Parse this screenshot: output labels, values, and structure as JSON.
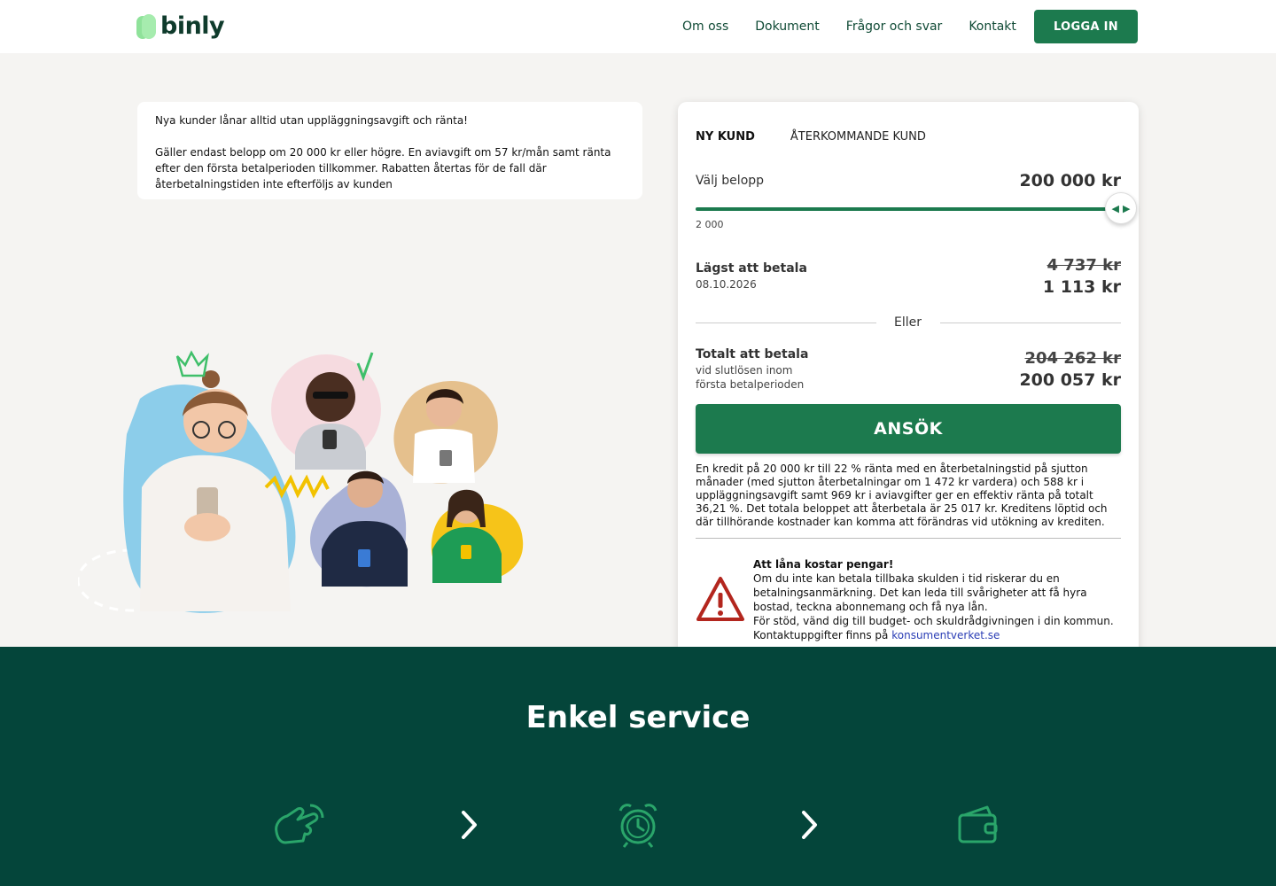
{
  "header": {
    "logo": "binly",
    "nav": [
      "Om oss",
      "Dokument",
      "Frågor och svar",
      "Kontakt"
    ],
    "login": "LOGGA IN"
  },
  "promo": {
    "line1": "Nya kunder lånar alltid utan uppläggningsavgift och ränta!",
    "line2": "Gäller endast belopp om 20 000 kr eller högre. En aviavgift om 57 kr/mån samt ränta efter den första betalperioden tillkommer. Rabatten återtas för de fall där återbetalningstiden inte efterföljs av kunden"
  },
  "calculator": {
    "tabs": [
      "NY KUND",
      "ÅTERKOMMANDE KUND"
    ],
    "active_tab": "NY KUND",
    "choose_label": "Välj belopp",
    "amount": "200 000 kr",
    "slider_min": "2 000",
    "slider_level": 1.0,
    "lowest_label": "Lägst att betala",
    "lowest_date": "08.10.2026",
    "lowest_old": "4 737 kr",
    "lowest_new": "1 113 kr",
    "or": "Eller",
    "total_label": "Totalt att betala",
    "total_sub1": "vid slutlösen inom",
    "total_sub2": "första betalperioden",
    "total_old": "204 262 kr",
    "total_new": "200 057 kr",
    "apply": "ANSÖK",
    "legal": "En kredit på 20 000 kr till 22 % ränta med en återbetalningstid på sjutton månader (med sjutton återbetalningar om 1 472 kr vardera) och 588 kr i uppläggningsavgift samt 969 kr i aviavgifter ger en effektiv ränta på totalt 36,21 %. Det totala beloppet att återbetala är 25 017 kr. Kreditens löptid och där tillhörande kostnader kan komma att förändras vid utökning av krediten.",
    "warning_title": "Att låna kostar pengar!",
    "warning_body": "Om du inte kan betala tillbaka skulden i tid riskerar du en betalningsanmärkning. Det kan leda till svårigheter att få hyra bostad, teckna abonnemang och få nya lån.",
    "warning_support": "För stöd, vänd dig till budget- och skuldrådgivningen i din kommun.",
    "warning_contact": "Kontaktuppgifter finns på",
    "warning_link": "konsumentverket.se"
  },
  "service": {
    "title": "Enkel service",
    "icons": [
      "hand-tap-icon",
      "chevron-right-icon",
      "alarm-clock-icon",
      "chevron-right-icon",
      "wallet-icon"
    ]
  },
  "colors": {
    "brand_green": "#1c7a4e",
    "dark_green": "#04453a",
    "logo_green": "#8fe29a"
  }
}
